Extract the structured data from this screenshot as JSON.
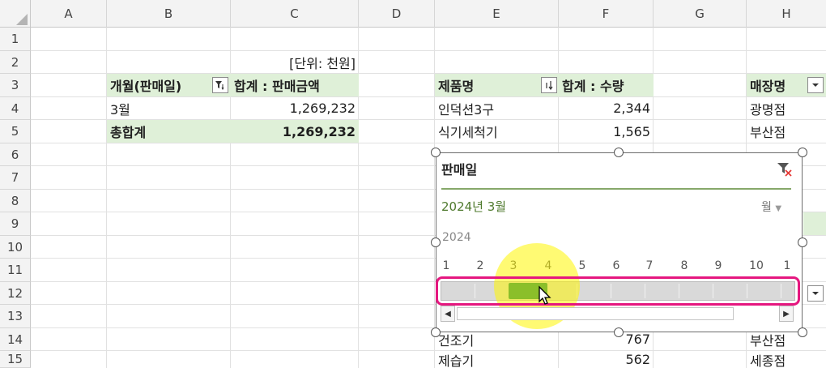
{
  "columns": [
    "A",
    "B",
    "C",
    "D",
    "E",
    "F",
    "G",
    "H"
  ],
  "rows": [
    "1",
    "2",
    "3",
    "4",
    "5",
    "6",
    "7",
    "8",
    "9",
    "10",
    "11",
    "12",
    "13",
    "14",
    "15"
  ],
  "pivot1": {
    "unit_note": "[단위: 천원]",
    "row_header": "개월(판매일)",
    "value_header": "합계 : 판매금액",
    "row_label": "3월",
    "row_value": "1,269,232",
    "total_label": "총합계",
    "total_value": "1,269,232"
  },
  "pivot2": {
    "row_header": "제품명",
    "value_header": "합계 : 수량",
    "items": [
      {
        "name": "인덕션3구",
        "qty": "2,344"
      },
      {
        "name": "식기세척기",
        "qty": "1,565"
      }
    ],
    "bottom_items": [
      {
        "name": "건조기",
        "qty": "767"
      },
      {
        "name": "제습기",
        "qty": "562"
      }
    ]
  },
  "pivot3": {
    "row_header": "매장명",
    "items": [
      "광명점",
      "부산점"
    ],
    "bottom_items": [
      "부산점",
      "세종점"
    ]
  },
  "slicer": {
    "title": "판매일",
    "selected_range": "2024년 3월",
    "time_level": "월",
    "year": "2024",
    "months": [
      "1",
      "2",
      "3",
      "4",
      "5",
      "6",
      "7",
      "8",
      "9",
      "10",
      "1"
    ],
    "selected_month": 3
  },
  "colors": {
    "pivot_green": "#dff0d8",
    "timeline_selected": "#8bbf2a",
    "highlight_border": "#e5177f",
    "cursor_spot": "#fff500"
  },
  "icons": {
    "filter_active": "funnel-filter-icon",
    "sort": "sort-descending-icon",
    "dropdown": "dropdown-arrow-icon",
    "clear_filter": "clear-filter-icon"
  }
}
